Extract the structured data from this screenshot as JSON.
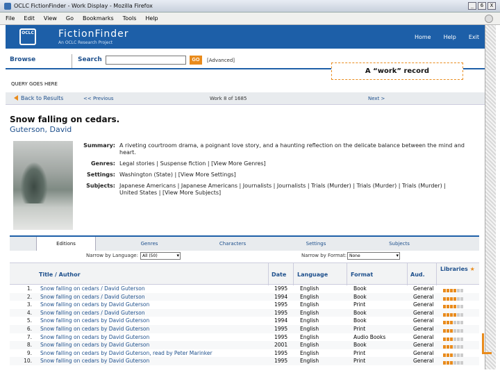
{
  "window": {
    "title": "OCLC FictionFinder - Work Display - Mozilla Firefox",
    "buttons": [
      "_",
      "6",
      "X"
    ]
  },
  "menu": [
    "File",
    "Edit",
    "View",
    "Go",
    "Bookmarks",
    "Tools",
    "Help"
  ],
  "header": {
    "logo": "OCLC",
    "brand": "FictionFinder",
    "subtitle": "An OCLC Research Project",
    "nav": [
      "Home",
      "Help",
      "Exit"
    ]
  },
  "search": {
    "browse": "Browse",
    "search": "Search",
    "go": "GO",
    "advanced": "[Advanced]",
    "value": ""
  },
  "callout": "A “work” record",
  "query": "QUERY GOES HERE",
  "nav": {
    "back": "Back to Results",
    "prev": "<< Previous",
    "position": "Work 8 of 1685",
    "next": "Next >"
  },
  "record": {
    "title": "Snow falling on cedars.",
    "author": "Guterson, David",
    "summary_label": "Summary:",
    "summary": "A riveting courtroom drama, a poignant love story, and a haunting reflection on the delicate balance between the mind and heart.",
    "genres_label": "Genres:",
    "genres": "Legal stories | Suspense fiction | [View More Genres]",
    "settings_label": "Settings:",
    "settings": "Washington (State) | [View More Settings]",
    "subjects_label": "Subjects:",
    "subjects": "Japanese Americans | Japanese Americans | Journalists | Journalists | Trials (Murder) | Trials (Murder) | Trials (Murder) | United States | [View More Subjects]"
  },
  "tabs": [
    "Editions",
    "Genres",
    "Characters",
    "Settings",
    "Subjects"
  ],
  "filters": {
    "language_label": "Narrow by Language:",
    "language_value": "All (50)",
    "format_label": "Narrow by Format:",
    "format_value": "None"
  },
  "table": {
    "headers": {
      "title": "Title / Author",
      "date": "Date",
      "language": "Language",
      "format": "Format",
      "audience": "Aud.",
      "libraries": "Libraries",
      "star": "★"
    },
    "rows": [
      {
        "n": "1.",
        "title": "Snow falling on cedars / David Guterson",
        "date": "1995",
        "lang": "English",
        "fmt": "Book",
        "aud": "General",
        "lib": 4
      },
      {
        "n": "2.",
        "title": "Snow falling on cedars / David Guterson",
        "date": "1994",
        "lang": "English",
        "fmt": "Book",
        "aud": "General",
        "lib": 4
      },
      {
        "n": "3.",
        "title": "Snow falling on cedars by David Guterson",
        "date": "1995",
        "lang": "English",
        "fmt": "Print",
        "aud": "General",
        "lib": 4
      },
      {
        "n": "4.",
        "title": "Snow falling on cedars / David Guterson",
        "date": "1995",
        "lang": "English",
        "fmt": "Book",
        "aud": "General",
        "lib": 4
      },
      {
        "n": "5.",
        "title": "Snow falling on cedars by David Guterson",
        "date": "1994",
        "lang": "English",
        "fmt": "Book",
        "aud": "General",
        "lib": 3
      },
      {
        "n": "6.",
        "title": "Snow falling on cedars by David Guterson",
        "date": "1995",
        "lang": "English",
        "fmt": "Print",
        "aud": "General",
        "lib": 3
      },
      {
        "n": "7.",
        "title": "Snow falling on cedars by David Guterson",
        "date": "1995",
        "lang": "English",
        "fmt": "Audio Books",
        "aud": "General",
        "lib": 3
      },
      {
        "n": "8.",
        "title": "Snow falling on cedars by David Guterson",
        "date": "2001",
        "lang": "English",
        "fmt": "Book",
        "aud": "General",
        "lib": 3
      },
      {
        "n": "9.",
        "title": "Snow falling on cedars by David Guterson, read by Peter Marinker",
        "date": "1995",
        "lang": "English",
        "fmt": "Print",
        "aud": "General",
        "lib": 3
      },
      {
        "n": "10.",
        "title": "Snow falling on cedars by David Guterson",
        "date": "1995",
        "lang": "English",
        "fmt": "Print",
        "aud": "General",
        "lib": 3
      }
    ]
  }
}
